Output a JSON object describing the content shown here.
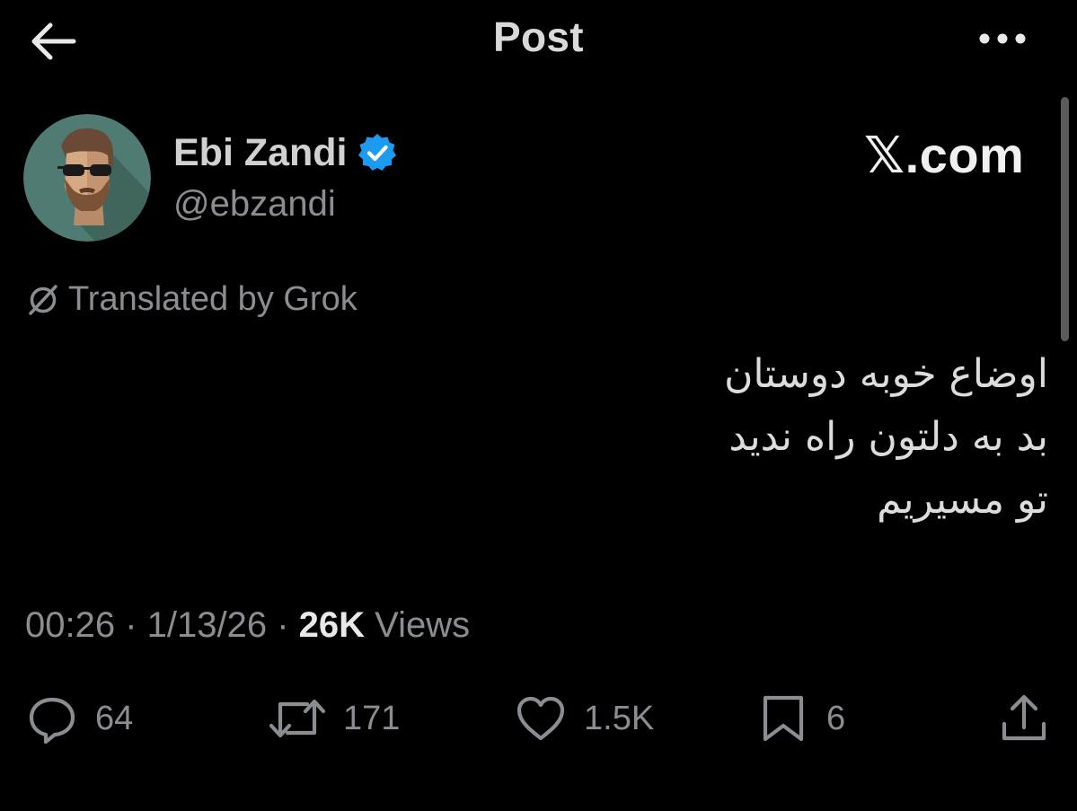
{
  "header": {
    "title": "Post",
    "back_icon": "arrow-left-icon",
    "more_icon": "more-horizontal-icon"
  },
  "author": {
    "name": "Ebi Zandi",
    "handle": "@ebzandi",
    "verified_icon": "verified-badge-icon",
    "avatar": "illustrated-avatar"
  },
  "watermark": "𝕏.com",
  "translation": {
    "icon": "grok-icon",
    "label": "Translated by Grok"
  },
  "tweet": {
    "lines": [
      "اوضاع خوبه دوستان",
      "بد به دلتون راه ندید",
      "تو مسیریم"
    ]
  },
  "meta": {
    "time": "00:26",
    "date": "1/13/26",
    "separator": " · ",
    "views_count": "26K",
    "views_label": " Views"
  },
  "actions": {
    "replies": "64",
    "reposts": "171",
    "likes": "1.5K",
    "bookmarks": "6"
  },
  "colors": {
    "background": "#000000",
    "verified": "#1d9bf0",
    "secondary_text": "#8a8d91",
    "avatar_bg": "#4f7b72"
  }
}
